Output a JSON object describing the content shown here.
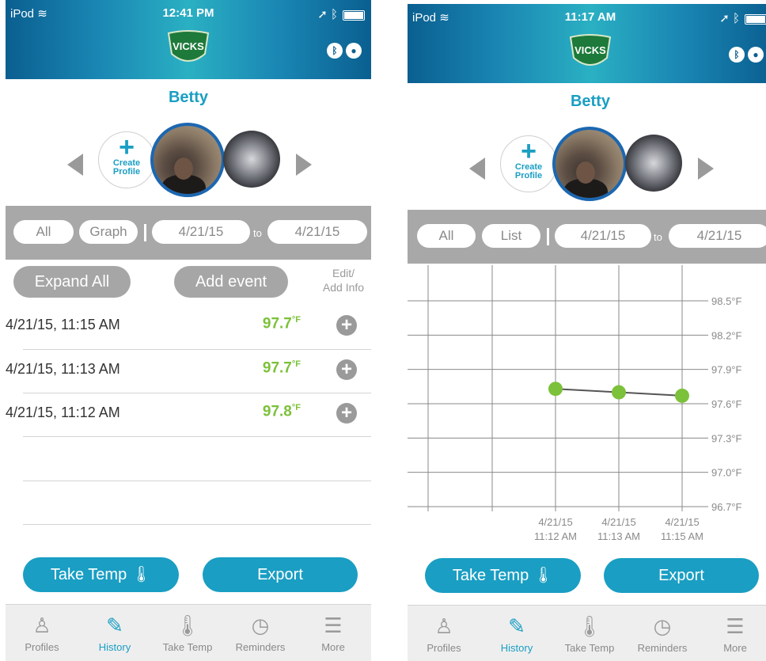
{
  "left": {
    "status": {
      "carrier": "iPod",
      "time": "12:41 PM"
    },
    "brand": "VICKS",
    "profile_name": "Betty",
    "create_profile": {
      "line1": "Create",
      "line2": "Profile"
    },
    "filter": {
      "all": "All",
      "view_toggle": "Graph",
      "from": "4/21/15",
      "to_label": "to",
      "to": "4/21/15"
    },
    "actions": {
      "expand_all": "Expand All",
      "add_event": "Add event",
      "edit_info_line1": "Edit/",
      "edit_info_line2": "Add Info"
    },
    "readings": [
      {
        "datetime": "4/21/15, 11:15 AM",
        "temp": "97.7",
        "unit": "°F"
      },
      {
        "datetime": "4/21/15, 11:13 AM",
        "temp": "97.7",
        "unit": "°F"
      },
      {
        "datetime": "4/21/15, 11:12 AM",
        "temp": "97.8",
        "unit": "°F"
      }
    ],
    "take_temp": "Take Temp",
    "export": "Export"
  },
  "right": {
    "status": {
      "carrier": "iPod",
      "time": "11:17 AM"
    },
    "brand": "VICKS",
    "profile_name": "Betty",
    "create_profile": {
      "line1": "Create",
      "line2": "Profile"
    },
    "filter": {
      "all": "All",
      "view_toggle": "List",
      "from": "4/21/15",
      "to_label": "to",
      "to": "4/21/15"
    },
    "take_temp": "Take Temp",
    "export": "Export"
  },
  "tabs": [
    {
      "label": "Profiles",
      "icon": "person-icon"
    },
    {
      "label": "History",
      "icon": "notepad-pencil-icon",
      "active": true
    },
    {
      "label": "Take Temp",
      "icon": "thermometer-icon"
    },
    {
      "label": "Reminders",
      "icon": "clock-icon"
    },
    {
      "label": "More",
      "icon": "menu-icon"
    }
  ],
  "colors": {
    "accent": "#1a9ec3",
    "temp_green": "#7cc13a",
    "filter_gray": "#a8a8a8",
    "header_blue": "#0a5f90"
  },
  "chart_data": {
    "type": "line",
    "x": [
      "4/21/15 11:12 AM",
      "4/21/15 11:13 AM",
      "4/21/15 11:15 AM"
    ],
    "x_labels": [
      [
        "4/21/15",
        "11:12 AM"
      ],
      [
        "4/21/15",
        "11:13 AM"
      ],
      [
        "4/21/15",
        "11:15 AM"
      ]
    ],
    "values": [
      97.73,
      97.7,
      97.67
    ],
    "y_ticks": [
      "98.5°F",
      "98.2°F",
      "97.9°F",
      "97.6°F",
      "97.3°F",
      "97.0°F",
      "96.7°F"
    ],
    "y_tick_values": [
      98.5,
      98.2,
      97.9,
      97.6,
      97.3,
      97.0,
      96.7
    ],
    "ylim": [
      96.7,
      98.5
    ],
    "grid": true,
    "point_color": "#7cc13a",
    "line_color": "#555555"
  }
}
